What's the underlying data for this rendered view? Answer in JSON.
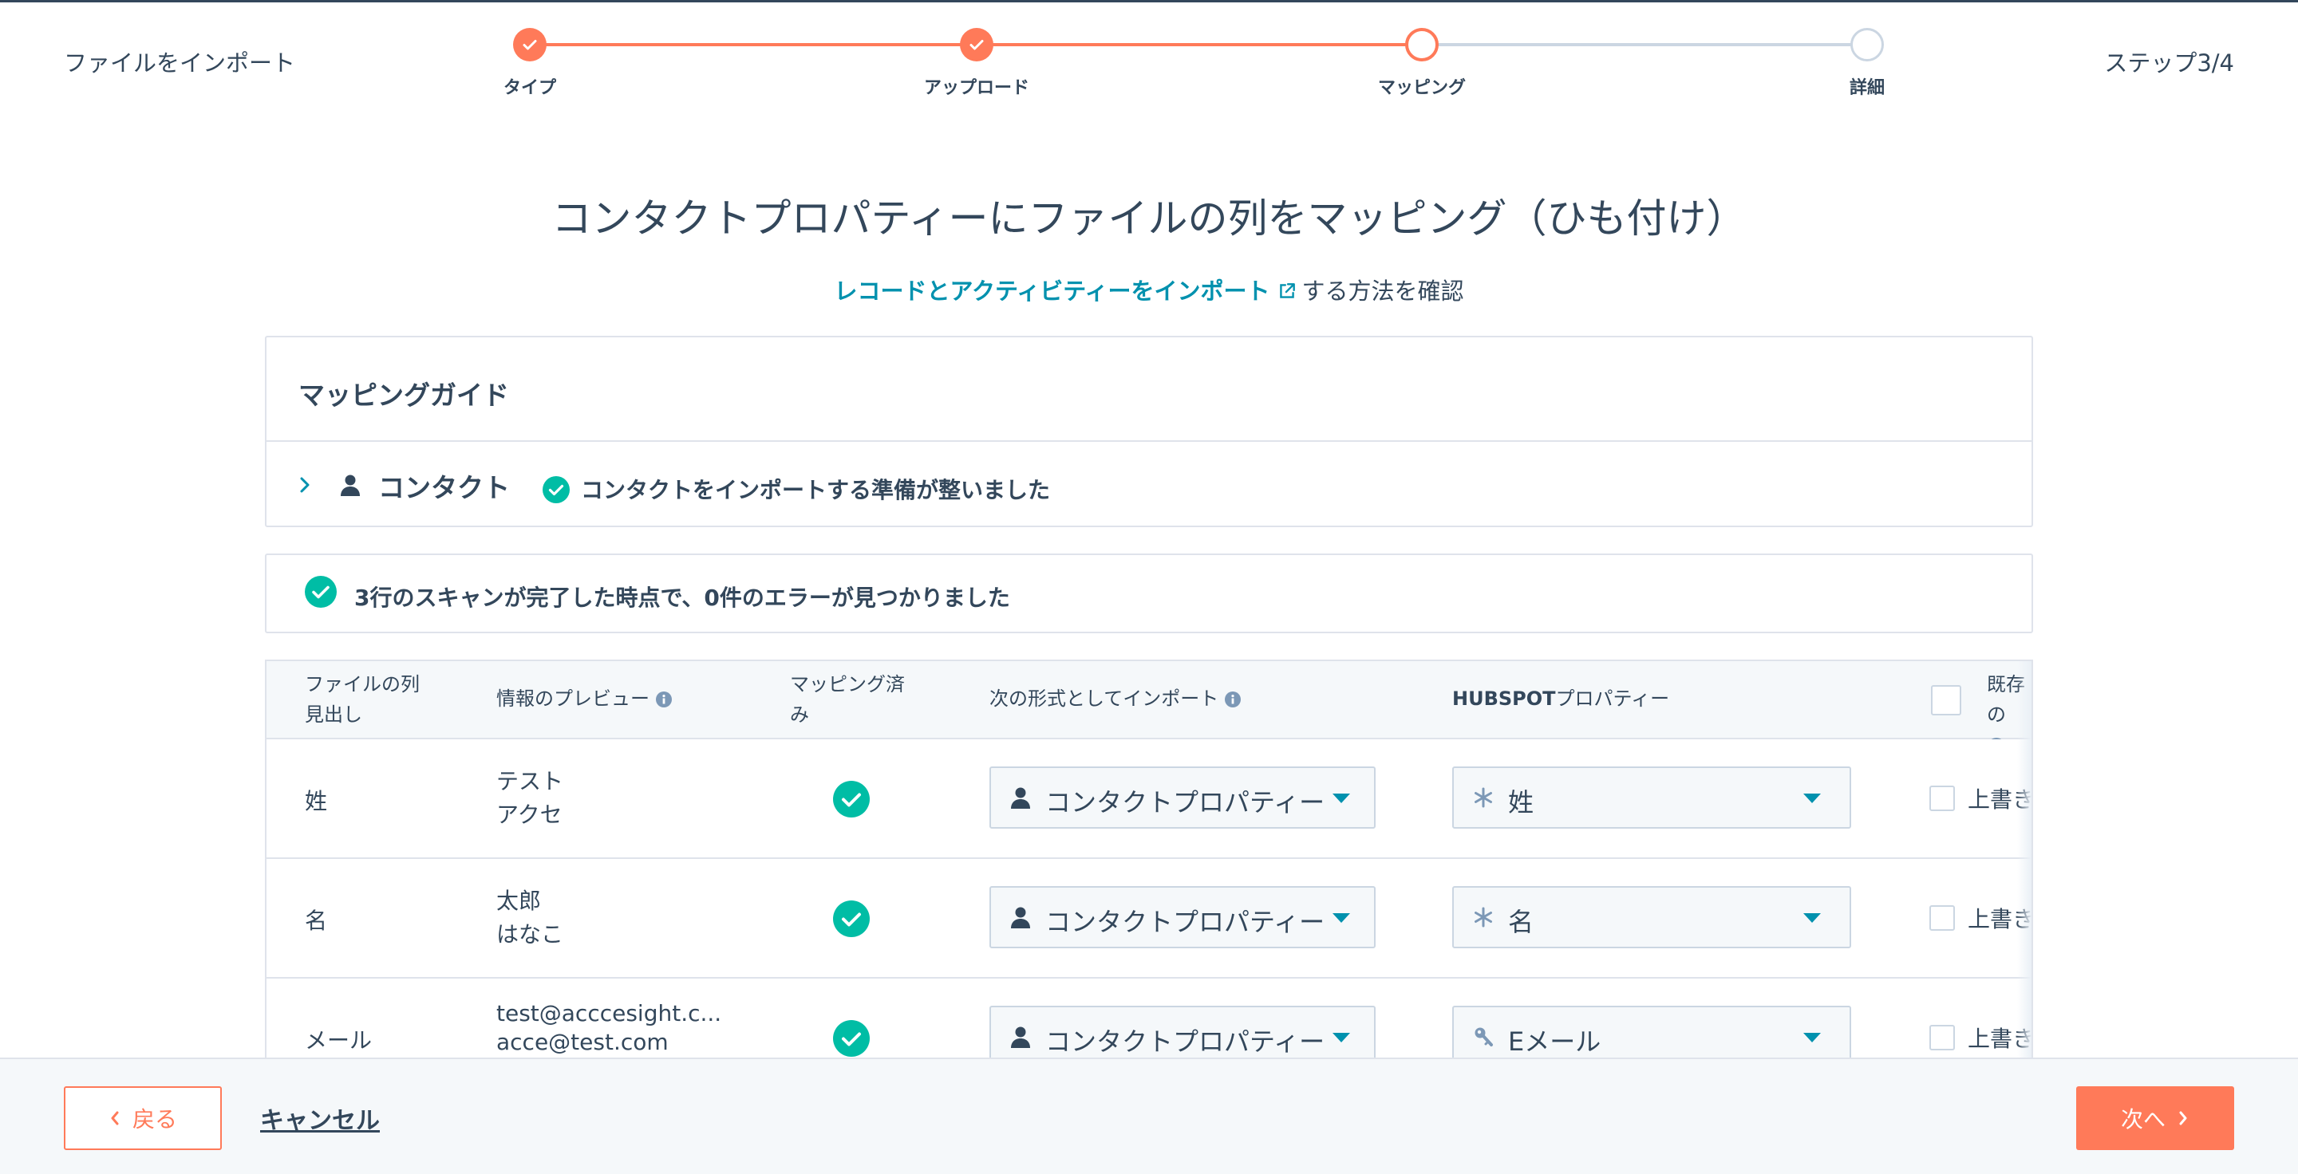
{
  "header": {
    "title": "ファイルをインポート",
    "step_counter": "ステップ3/4"
  },
  "stepper": {
    "steps": [
      {
        "label": "タイプ",
        "state": "done"
      },
      {
        "label": "アップロード",
        "state": "done"
      },
      {
        "label": "マッピング",
        "state": "current"
      },
      {
        "label": "詳細",
        "state": "todo"
      }
    ]
  },
  "main": {
    "title": "コンタクトプロパティーにファイルの列をマッピング（ひも付け）",
    "help_link": "レコードとアクティビティーをインポート",
    "help_suffix": "する方法を確認"
  },
  "guide": {
    "title": "マッピングガイド",
    "object_label": "コンタクト",
    "status": "コンタクトをインポートする準備が整いました"
  },
  "scan": {
    "message": "3行のスキャンが完了した時点で、0件のエラーが見つかりました"
  },
  "table": {
    "headers": {
      "column_line1": "ファイルの列",
      "column_line2": "見出し",
      "preview": "情報のプレビュー",
      "mapped_line1": "マッピング済",
      "mapped_line2": "み",
      "import_as": "次の形式としてインポート",
      "property_bold": "HUBSPOT",
      "property_rest": "プロパティー",
      "existing": "既存の"
    },
    "rows": [
      {
        "name": "姓",
        "preview1": "テスト",
        "preview2": "アクセ",
        "import_as": "コンタクトプロパティー",
        "property": "姓",
        "property_icon": "asterisk-icon",
        "overwrite": "上書き"
      },
      {
        "name": "名",
        "preview1": "太郎",
        "preview2": "はなこ",
        "import_as": "コンタクトプロパティー",
        "property": "名",
        "property_icon": "asterisk-icon",
        "overwrite": "上書き"
      },
      {
        "name": "メール",
        "preview1": "test@acccesight.c...",
        "preview2": "acce@test.com",
        "import_as": "コンタクトプロパティー",
        "property": "Eメール",
        "property_icon": "key-icon",
        "overwrite": "上書き"
      }
    ]
  },
  "footer": {
    "back": "戻る",
    "cancel": "キャンセル",
    "next": "次へ"
  },
  "colors": {
    "accent": "#ff7a59",
    "link": "#0091ae",
    "success": "#00bda5",
    "text": "#33475b"
  }
}
